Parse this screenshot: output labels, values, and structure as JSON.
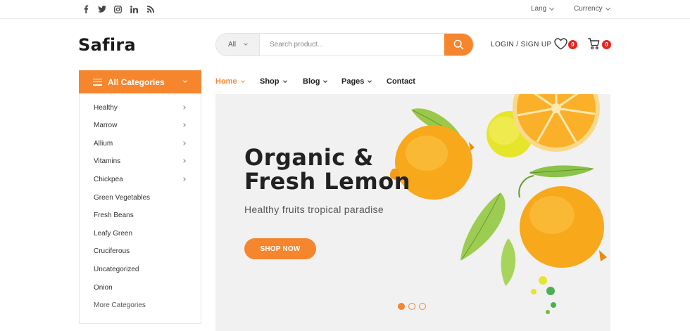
{
  "topbar": {
    "social_icons": [
      "facebook-icon",
      "twitter-icon",
      "instagram-icon",
      "linkedin-icon",
      "rss-icon"
    ],
    "lang_label": "Lang",
    "currency_label": "Currency"
  },
  "header": {
    "logo_text": "Safira",
    "search": {
      "category_value": "All",
      "placeholder": "Search product..."
    },
    "login_label": "LOGIN / SIGN UP",
    "wishlist_count": "0",
    "cart_count": "0"
  },
  "categories": {
    "title": "All Categories",
    "items": [
      {
        "label": "Healthy",
        "has_sub": true
      },
      {
        "label": "Marrow",
        "has_sub": true
      },
      {
        "label": "Allium",
        "has_sub": true
      },
      {
        "label": "Vitamins",
        "has_sub": true
      },
      {
        "label": "Chickpea",
        "has_sub": true
      },
      {
        "label": "Green Vegetables",
        "has_sub": false
      },
      {
        "label": "Fresh Beans",
        "has_sub": false
      },
      {
        "label": "Leafy Green",
        "has_sub": false
      },
      {
        "label": "Cruciferous",
        "has_sub": false
      },
      {
        "label": "Uncategorized",
        "has_sub": false
      },
      {
        "label": "Onion",
        "has_sub": false
      }
    ],
    "more_label": "More Categories"
  },
  "nav": {
    "items": [
      {
        "label": "Home",
        "active": true
      },
      {
        "label": "Shop",
        "active": false
      },
      {
        "label": "Blog",
        "active": false
      },
      {
        "label": "Pages",
        "active": false
      },
      {
        "label": "Contact",
        "active": false
      }
    ]
  },
  "hero": {
    "title_line1": "Organic &",
    "title_line2": "Fresh Lemon",
    "subtitle": "Healthy fruits tropical paradise",
    "button_label": "SHOP NOW",
    "slide_count": 3,
    "active_slide": 1
  },
  "colors": {
    "accent": "#f5862e",
    "badge": "#e8241c",
    "hero_bg": "#f1f1f1"
  }
}
